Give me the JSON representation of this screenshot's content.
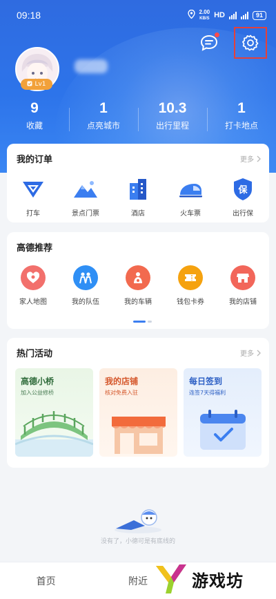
{
  "status_bar": {
    "time": "09:18",
    "speed_value": "2.00",
    "speed_unit": "KB/S",
    "hd": "HD",
    "battery": "91"
  },
  "header": {
    "settings_highlight_color": "#e5403a"
  },
  "profile": {
    "level": "Lv1"
  },
  "stats": [
    {
      "value": "9",
      "label": "收藏"
    },
    {
      "value": "1",
      "label": "点亮城市"
    },
    {
      "value": "10.3",
      "label": "出行里程"
    },
    {
      "value": "1",
      "label": "打卡地点"
    }
  ],
  "orders": {
    "title": "我的订单",
    "more": "更多",
    "items": [
      {
        "label": "打车",
        "icon": "taxi-icon"
      },
      {
        "label": "景点门票",
        "icon": "mountain-icon"
      },
      {
        "label": "酒店",
        "icon": "hotel-icon"
      },
      {
        "label": "火车票",
        "icon": "train-icon"
      },
      {
        "label": "出行保",
        "icon": "shield-icon"
      }
    ]
  },
  "recommend": {
    "title": "高德推荐",
    "items": [
      {
        "label": "家人地图",
        "icon": "family-map-icon"
      },
      {
        "label": "我的队伍",
        "icon": "team-icon"
      },
      {
        "label": "我的车辆",
        "icon": "car-owner-icon"
      },
      {
        "label": "钱包卡券",
        "icon": "coupon-icon"
      },
      {
        "label": "我的店铺",
        "icon": "store-icon"
      }
    ]
  },
  "activities": {
    "title": "热门活动",
    "more": "更多",
    "items": [
      {
        "title": "高德小桥",
        "subtitle": "加入公益修桥"
      },
      {
        "title": "我的店铺",
        "subtitle": "核对免费入驻"
      },
      {
        "title": "每日签到",
        "subtitle": "连签7天得福利"
      }
    ]
  },
  "empty_note": "没有了，小德可是有底线的",
  "bottom_nav": [
    {
      "label": "首页"
    },
    {
      "label": "附近"
    }
  ],
  "watermark": "游戏坊"
}
